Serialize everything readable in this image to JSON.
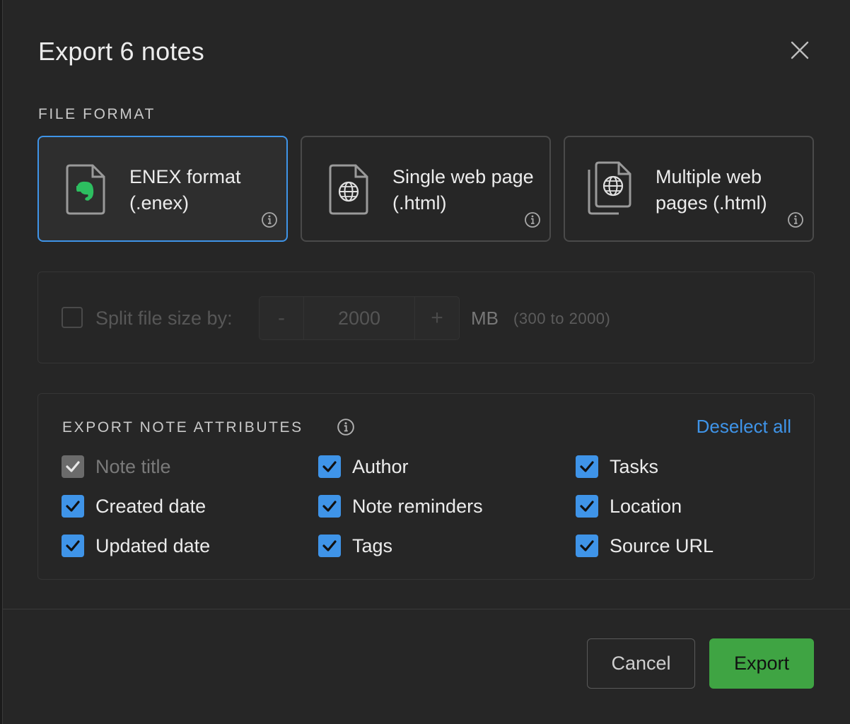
{
  "dialog": {
    "title": "Export 6 notes"
  },
  "file_format": {
    "label": "FILE FORMAT",
    "options": [
      {
        "label": "ENEX format (.enex)",
        "icon": "evernote-file-icon",
        "selected": true
      },
      {
        "label": "Single web page (.html)",
        "icon": "globe-file-icon",
        "selected": false
      },
      {
        "label": "Multiple web pages (.html)",
        "icon": "multiple-globe-files-icon",
        "selected": false
      }
    ]
  },
  "split": {
    "label": "Split file size by:",
    "value": "2000",
    "minus": "-",
    "plus": "+",
    "unit": "MB",
    "range": "(300 to 2000)",
    "checked": false
  },
  "attributes": {
    "label": "EXPORT NOTE ATTRIBUTES",
    "deselect_label": "Deselect all",
    "items": [
      {
        "label": "Note title",
        "checked": true,
        "disabled": true
      },
      {
        "label": "Author",
        "checked": true
      },
      {
        "label": "Tasks",
        "checked": true
      },
      {
        "label": "Created date",
        "checked": true
      },
      {
        "label": "Note reminders",
        "checked": true
      },
      {
        "label": "Location",
        "checked": true
      },
      {
        "label": "Updated date",
        "checked": true
      },
      {
        "label": "Tags",
        "checked": true
      },
      {
        "label": "Source URL",
        "checked": true
      }
    ]
  },
  "footer": {
    "cancel_label": "Cancel",
    "export_label": "Export"
  },
  "colors": {
    "accent": "#3f94e8",
    "export_green": "#3fa443",
    "evernote_green": "#2dbe60"
  }
}
